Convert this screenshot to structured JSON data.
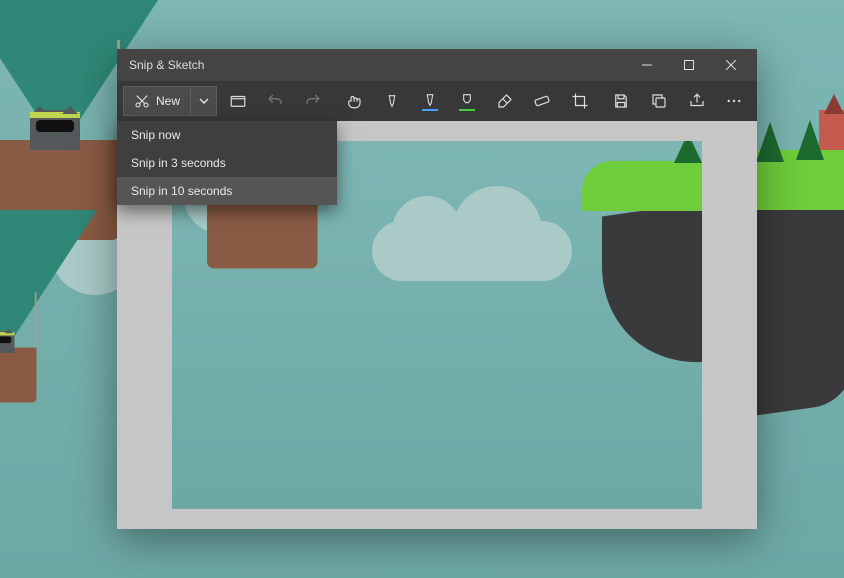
{
  "window": {
    "title": "Snip & Sketch"
  },
  "toolbar": {
    "new_label": "New"
  },
  "dropdown": {
    "items": [
      {
        "label": "Snip now"
      },
      {
        "label": "Snip in 3 seconds"
      },
      {
        "label": "Snip in 10 seconds"
      }
    ]
  }
}
